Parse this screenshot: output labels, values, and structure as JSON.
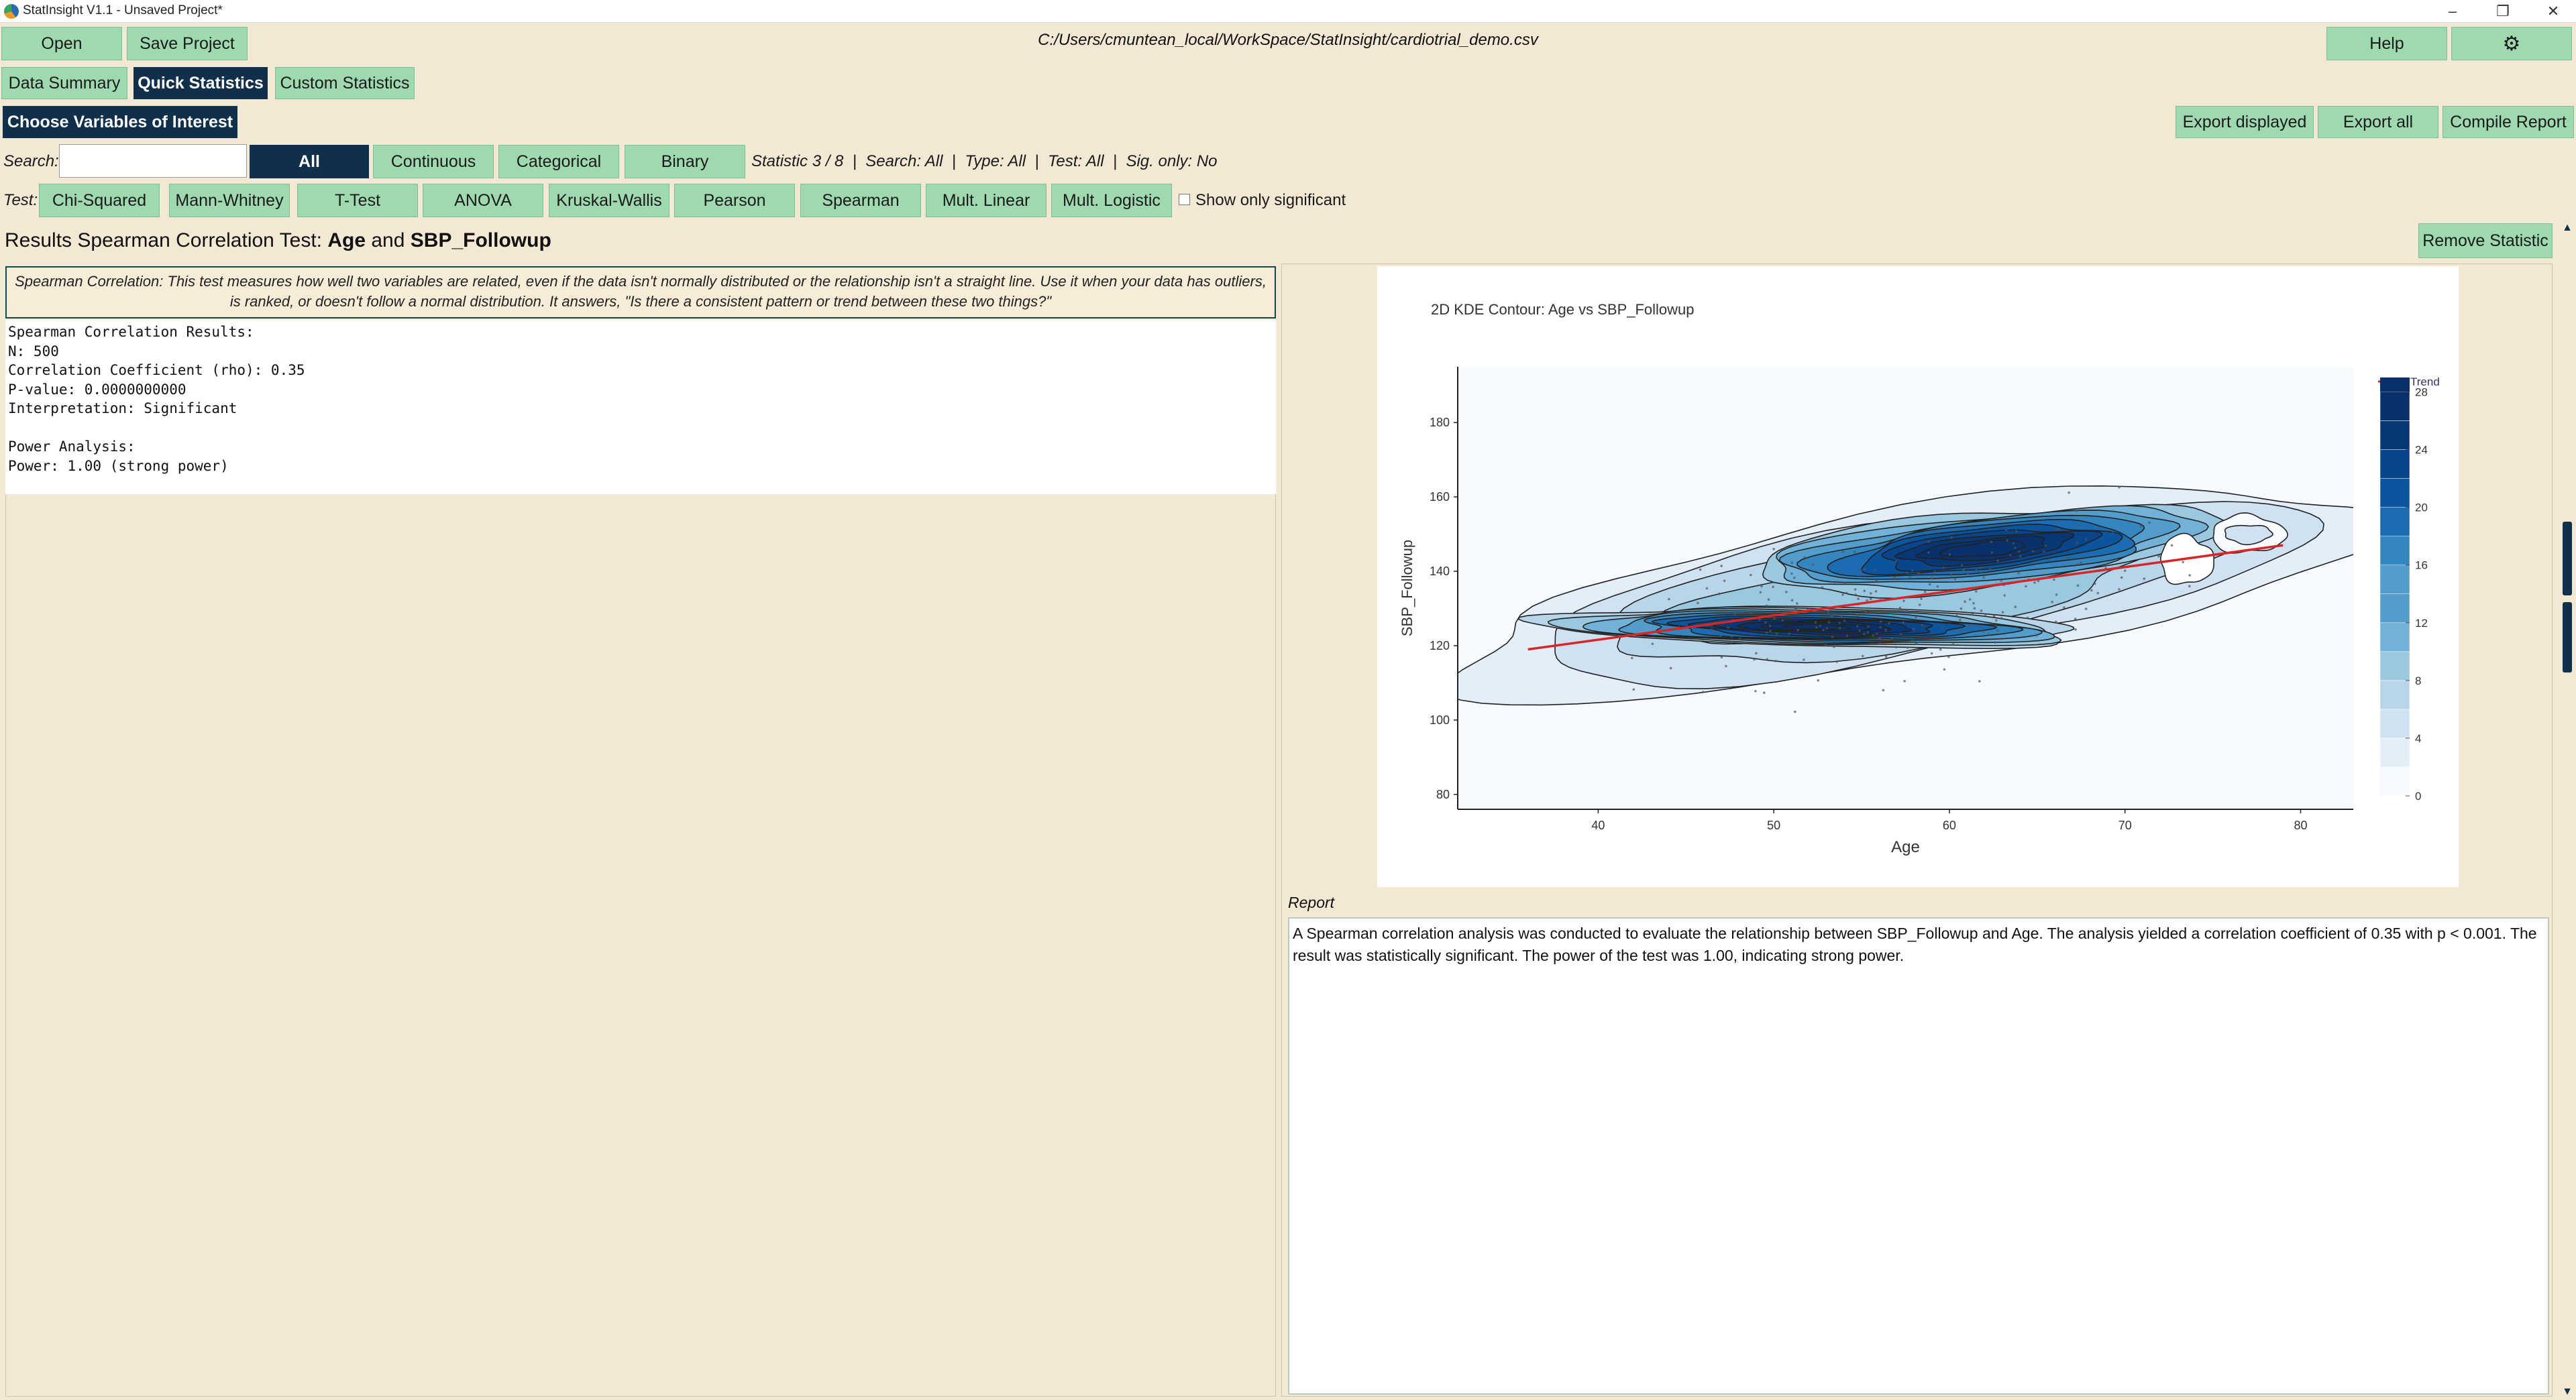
{
  "window": {
    "title": "StatInsight V1.1 - Unsaved Project*"
  },
  "toolbar": {
    "open": "Open",
    "save_project": "Save Project",
    "file_path": "C:/Users/cmuntean_local/WorkSpace/StatInsight/cardiotrial_demo.csv",
    "help": "Help"
  },
  "tabs": [
    "Data Summary",
    "Quick Statistics",
    "Custom Statistics"
  ],
  "choose_variables": "Choose Variables of Interest",
  "export": {
    "displayed": "Export displayed",
    "all": "Export all",
    "compile": "Compile Report"
  },
  "search": {
    "label": "Search:",
    "value": "",
    "placeholder": "",
    "type_filters": [
      "All",
      "Continuous",
      "Categorical",
      "Binary"
    ],
    "status": "Statistic 3 / 8  |  Search: All  |  Type: All  |  Test: All  |  Sig. only: No"
  },
  "tests": {
    "label": "Test:",
    "items": [
      "Chi-Squared",
      "Mann-Whitney",
      "T-Test",
      "ANOVA",
      "Kruskal-Wallis",
      "Pearson",
      "Spearman",
      "Mult. Linear",
      "Mult. Logistic"
    ],
    "show_only_significant": "Show only significant"
  },
  "results": {
    "prefix": "Results Spearman Correlation Test: ",
    "var1": "Age",
    "and": " and ",
    "var2": "SBP_Followup",
    "remove": "Remove Statistic",
    "description": "Spearman Correlation: This test measures how well two variables are related, even if the data isn't normally distributed or the relationship isn't a straight line. Use it when your data has outliers, is ranked, or doesn't follow a normal distribution. It answers, \"Is there a consistent pattern or trend between these two things?\"",
    "output": "Spearman Correlation Results:\nN: 500\nCorrelation Coefficient (rho): 0.35\nP-value: 0.0000000000\nInterpretation: Significant\n\nPower Analysis:\nPower: 1.00 (strong power)"
  },
  "report": {
    "label": "Report",
    "text": "A Spearman correlation analysis was conducted to evaluate the relationship between SBP_Followup and Age. The analysis yielded a correlation coefficient of 0.35 with p < 0.001. The result was statistically significant. The power of the test was 1.00, indicating strong power."
  },
  "chart_data": {
    "type": "contour",
    "title": "2D KDE Contour: Age vs SBP_Followup",
    "xlabel": "Age",
    "ylabel": "SBP_Followup",
    "xlim": [
      32,
      83
    ],
    "ylim": [
      76,
      195
    ],
    "x_ticks": [
      40,
      50,
      60,
      70,
      80
    ],
    "y_ticks": [
      80,
      100,
      120,
      140,
      160,
      180
    ],
    "colorbar": {
      "ticks": [
        0,
        4,
        8,
        12,
        16,
        20,
        24,
        28
      ],
      "colormap": "Blues"
    },
    "legend": [
      "Trend"
    ],
    "trend_line": {
      "x": [
        36,
        79
      ],
      "y": [
        119,
        147
      ],
      "color": "#d62728"
    },
    "density_centers": [
      {
        "x": 52.5,
        "y": 125,
        "rx": 7,
        "ry": 7,
        "levels": 12
      },
      {
        "x": 62,
        "y": 146,
        "rx": 7,
        "ry": 10,
        "levels": 10
      },
      {
        "x": 58,
        "y": 135,
        "rx": 16,
        "ry": 22,
        "levels": 4
      }
    ],
    "n_points": 500
  },
  "colors": {
    "background": "#f3e8d4",
    "button": "#9fd9b0",
    "active": "#0f2f4a",
    "trend": "#d62728"
  }
}
